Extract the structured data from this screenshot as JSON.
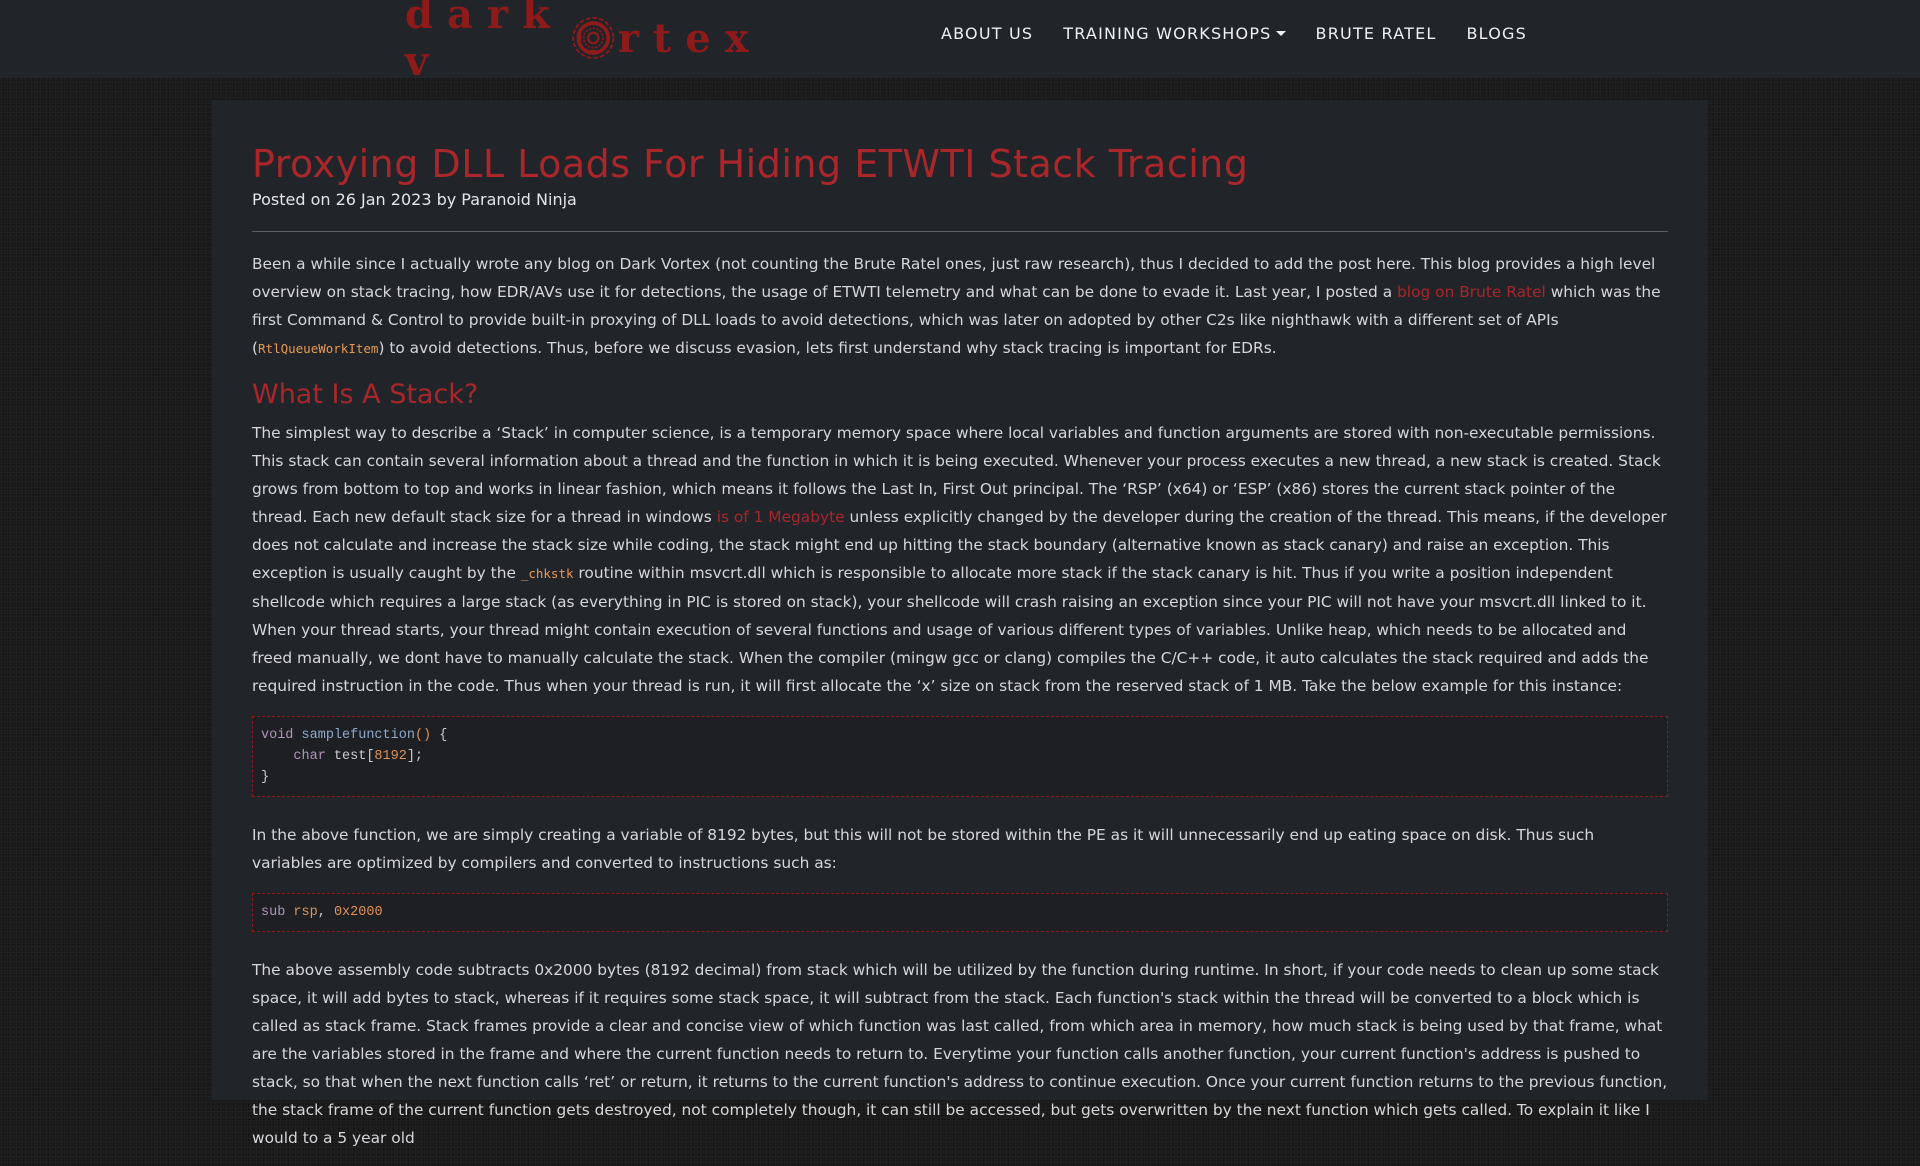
{
  "brand": {
    "logo_left": "dark v",
    "logo_right": "rtex",
    "logo_icon": "vortex-ring-icon"
  },
  "nav": {
    "items": [
      {
        "label": "ABOUT US"
      },
      {
        "label": "TRAINING WORKSHOPS",
        "has_dropdown": true
      },
      {
        "label": "BRUTE RATEL"
      },
      {
        "label": "BLOGS"
      }
    ]
  },
  "colors": {
    "accent": "#a9262a",
    "background": "#212429",
    "code_orange": "#e89a55"
  },
  "article": {
    "title": "Proxying DLL Loads For Hiding ETWTI Stack Tracing",
    "meta": "Posted on 26 Jan 2023 by Paranoid Ninja",
    "intro": {
      "t1": "Been a while since I actually wrote any blog on Dark Vortex (not counting the Brute Ratel ones, just raw research), thus I decided to add the post here. This blog provides a high level overview on stack tracing, how EDR/AVs use it for detections, the usage of ETWTI telemetry and what can be done to evade it. Last year, I posted a ",
      "link": "blog on Brute Ratel",
      "t2": " which was the first Command & Control to provide built-in proxying of DLL loads to avoid detections, which was later on adopted by other C2s like nighthawk with a different set of APIs (",
      "code": "RtlQueueWorkItem",
      "t3": ") to avoid detections. Thus, before we discuss evasion, lets first understand why stack tracing is important for EDRs."
    },
    "section1_heading": "What Is A Stack?",
    "p2": {
      "t1": "The simplest way to describe a ‘Stack’ in computer science, is a temporary memory space where local variables and function arguments are stored with non-executable permissions. This stack can contain several information about a thread and the function in which it is being executed. Whenever your process executes a new thread, a new stack is created. Stack grows from bottom to top and works in linear fashion, which means it follows the Last In, First Out principal. The ‘RSP’ (x64) or ‘ESP’ (x86) stores the current stack pointer of the thread. Each new default stack size for a thread in windows ",
      "link": "is of 1 Megabyte",
      "t2": " unless explicitly changed by the developer during the creation of the thread. This means, if the developer does not calculate and increase the stack size while coding, the stack might end up hitting the stack boundary (alternative known as stack canary) and raise an exception. This exception is usually caught by the ",
      "code": "_chkstk",
      "t3": " routine within msvcrt.dll which is responsible to allocate more stack if the stack canary is hit. Thus if you write a position independent shellcode which requires a large stack (as everything in PIC is stored on stack), your shellcode will crash raising an exception since your PIC will not have your msvcrt.dll linked to it. When your thread starts, your thread might contain execution of several functions and usage of various different types of variables. Unlike heap, which needs to be allocated and freed manually, we dont have to manually calculate the stack. When the compiler (mingw gcc or clang) compiles the C/C++ code, it auto calculates the stack required and adds the required instruction in the code. Thus when your thread is run, it will first allocate the ‘x’ size on stack from the reserved stack of 1 MB. Take the below example for this instance:"
    },
    "code1": {
      "l1_kw": "void",
      "l1_fn": "samplefunction",
      "l1_parens": "()",
      "l1_brace": " {",
      "l2_indent": "    ",
      "l2_kw": "char",
      "l2_a": " test[",
      "l2_num": "8192",
      "l2_b": "];",
      "l3": "}"
    },
    "p3": "In the above function, we are simply creating a variable of 8192 bytes, but this will not be stored within the PE as it will unnecessarily end up eating space on disk. Thus such variables are optimized by compilers and converted to instructions such as:",
    "code2": {
      "op": "sub",
      "reg": "rsp",
      "comma": ", ",
      "imm": "0x2000"
    },
    "p4": "The above assembly code subtracts 0x2000 bytes (8192 decimal) from stack which will be utilized by the function during runtime. In short, if your code needs to clean up some stack space, it will add bytes to stack, whereas if it requires some stack space, it will subtract from the stack. Each function's stack within the thread will be converted to a block which is called as stack frame. Stack frames provide a clear and concise view of which function was last called, from which area in memory, how much stack is being used by that frame, what are the variables stored in the frame and where the current function needs to return to. Everytime your function calls another function, your current function's address is pushed to stack, so that when the next function calls ‘ret’ or return, it returns to the current function's address to continue execution. Once your current function returns to the previous function, the stack frame of the current function gets destroyed, not completely though, it can still be accessed, but gets overwritten by the next function which gets called. To explain it like I would to a 5 year old"
  }
}
